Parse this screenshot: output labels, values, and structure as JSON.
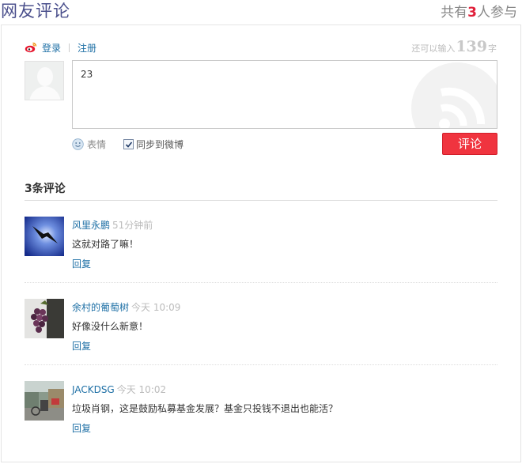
{
  "header": {
    "title": "网友评论",
    "count_prefix": "共有",
    "count_value": "3",
    "count_suffix": "人参与"
  },
  "login": {
    "login_label": "登录",
    "register_label": "注册",
    "icon": "weibo-icon"
  },
  "composer": {
    "remain_prefix": "还可以输入",
    "remain_value": "139",
    "remain_suffix": "字",
    "input_value": "23",
    "emoticon_label": "表情",
    "sync_label": "同步到微博",
    "sync_checked": true,
    "submit_label": "评论"
  },
  "comments_section": {
    "title": "3条评论",
    "reply_label": "回复",
    "items": [
      {
        "user": "风里永鹏",
        "time": "51分钟前",
        "text": "这就对路了嘛！"
      },
      {
        "user": "余村的葡萄树",
        "time": "今天 10:09",
        "text": "好像没什么新意！"
      },
      {
        "user": "JACKDSG",
        "time": "今天 10:02",
        "text": "垃圾肖钢，这是鼓励私募基金发展？基金只投钱不退出也能活？"
      }
    ]
  },
  "colors": {
    "accent_red": "#f0343f",
    "link_blue": "#1d6fa5",
    "title_purple": "#4a4f8c"
  }
}
